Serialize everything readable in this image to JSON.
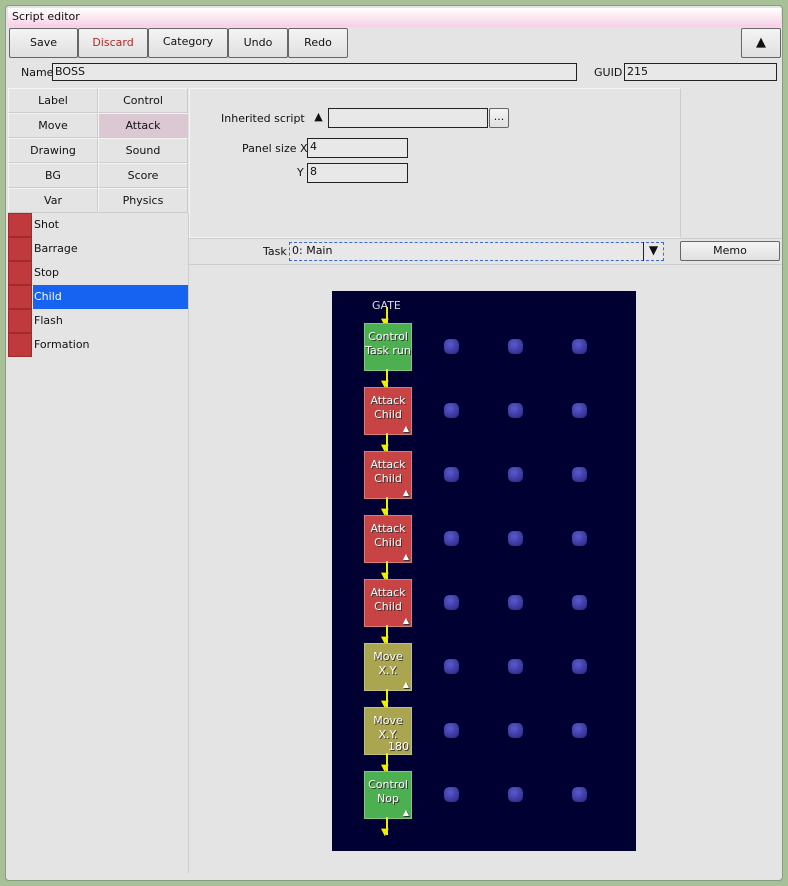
{
  "window": {
    "title": "Script editor"
  },
  "toolbar": {
    "save": "Save",
    "discard": "Discard",
    "category": "Category",
    "undo": "Undo",
    "redo": "Redo",
    "collapse": "▲"
  },
  "name": {
    "label": "Name",
    "value": "BOSS"
  },
  "guid": {
    "label": "GUID",
    "value": "215"
  },
  "categories": [
    "Label",
    "Control",
    "Move",
    "Attack",
    "Drawing",
    "Sound",
    "BG",
    "Score",
    "Var",
    "Physics"
  ],
  "selected_category": "Attack",
  "commands": [
    "Shot",
    "Barrage",
    "Stop",
    "Child",
    "Flash",
    "Formation"
  ],
  "selected_command": "Child",
  "props": {
    "inherited_label": "Inherited script",
    "inherited_btn": "▲",
    "inherited_value": "",
    "browse": "...",
    "panel_x_label": "Panel size X",
    "panel_x": "4",
    "panel_y_label": "Y",
    "panel_y": "8"
  },
  "task": {
    "label": "Task",
    "value": "0: Main",
    "arrow": "▼",
    "memo": "Memo"
  },
  "canvas": {
    "gate": "GATE",
    "nodes": [
      {
        "l1": "Control",
        "l2": "Task run",
        "color": "#4caf50",
        "tri": false,
        "num": ""
      },
      {
        "l1": "Attack",
        "l2": "Child",
        "color": "#c84444",
        "tri": true,
        "num": ""
      },
      {
        "l1": "Attack",
        "l2": "Child",
        "color": "#c84444",
        "tri": true,
        "num": ""
      },
      {
        "l1": "Attack",
        "l2": "Child",
        "color": "#c84444",
        "tri": true,
        "num": ""
      },
      {
        "l1": "Attack",
        "l2": "Child",
        "color": "#c84444",
        "tri": true,
        "num": ""
      },
      {
        "l1": "Move",
        "l2": "X.Y.",
        "color": "#aaa650",
        "tri": true,
        "num": ""
      },
      {
        "l1": "Move",
        "l2": "X.Y.",
        "color": "#aaa650",
        "tri": false,
        "num": "180"
      },
      {
        "l1": "Control",
        "l2": "Nop",
        "color": "#4caf50",
        "tri": true,
        "num": ""
      }
    ],
    "dot_columns": 3
  }
}
